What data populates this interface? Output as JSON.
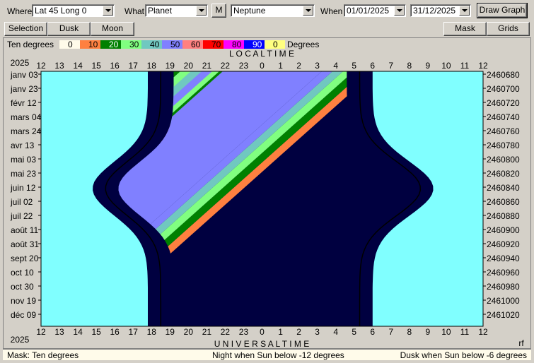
{
  "toolbar": {
    "where_label": "Where",
    "where_value": "Lat 45 Long 0",
    "what_label": "What",
    "what_value": "Planet",
    "m_button": "M",
    "object_value": "Neptune",
    "when_label": "When",
    "date_from": "01/01/2025",
    "date_to": "31/12/2025",
    "draw_button": "Draw Graph"
  },
  "tabs": {
    "selection": "Selection",
    "dusk": "Dusk",
    "moon": "Moon",
    "mask": "Mask",
    "grids": "Grids"
  },
  "legend": {
    "title": "Ten degrees",
    "unit": "Degrees",
    "steps": [
      {
        "label": "0",
        "color": "#fffbea"
      },
      {
        "label": "10",
        "color": "#ff8040"
      },
      {
        "label": "20",
        "color": "#008000"
      },
      {
        "label": "30",
        "color": "#80ff80"
      },
      {
        "label": "40",
        "color": "#70c8c0"
      },
      {
        "label": "50",
        "color": "#8080ff"
      },
      {
        "label": "60",
        "color": "#ff8080"
      },
      {
        "label": "70",
        "color": "#ff0000"
      },
      {
        "label": "80",
        "color": "#ff00ff"
      },
      {
        "label": "90",
        "color": "#0000ff"
      },
      {
        "label": "0",
        "color": "#ffff80"
      }
    ]
  },
  "chart": {
    "year_top": "2025",
    "year_bottom": "2025",
    "local_time_title": "L O C A L     T I M E",
    "universal_time_title": "U N I V E R S A L     T I M E",
    "hours": [
      "12",
      "13",
      "14",
      "15",
      "16",
      "17",
      "18",
      "19",
      "20",
      "21",
      "22",
      "23",
      "0",
      "1",
      "2",
      "3",
      "4",
      "5",
      "6",
      "7",
      "8",
      "9",
      "10",
      "11",
      "12"
    ],
    "date_labels": [
      "janv 03",
      "janv 23",
      "févr 12",
      "mars 04",
      "mars 24",
      "avr 13",
      "mai 03",
      "mai 23",
      "juin 12",
      "juil 02",
      "juil 22",
      "août 11",
      "août 31",
      "sept 20",
      "oct 10",
      "oct 30",
      "nov 19",
      "déc 09"
    ],
    "jd_labels": [
      "2460680",
      "2460700",
      "2460720",
      "2460740",
      "2460760",
      "2460780",
      "2460800",
      "2460820",
      "2460840",
      "2460860",
      "2460880",
      "2460900",
      "2460920",
      "2460940",
      "2460960",
      "2460980",
      "2461000",
      "2461020"
    ],
    "corner_mark": "rf",
    "colors": {
      "day": "#80ffff",
      "dusk_outer": "#0080c0",
      "dusk_inner": "#004080",
      "night": "#000040"
    }
  },
  "status": {
    "left": "Mask:  Ten degrees",
    "center": "Night when Sun below -12 degrees",
    "right": "Dusk when Sun below -6 degrees"
  }
}
